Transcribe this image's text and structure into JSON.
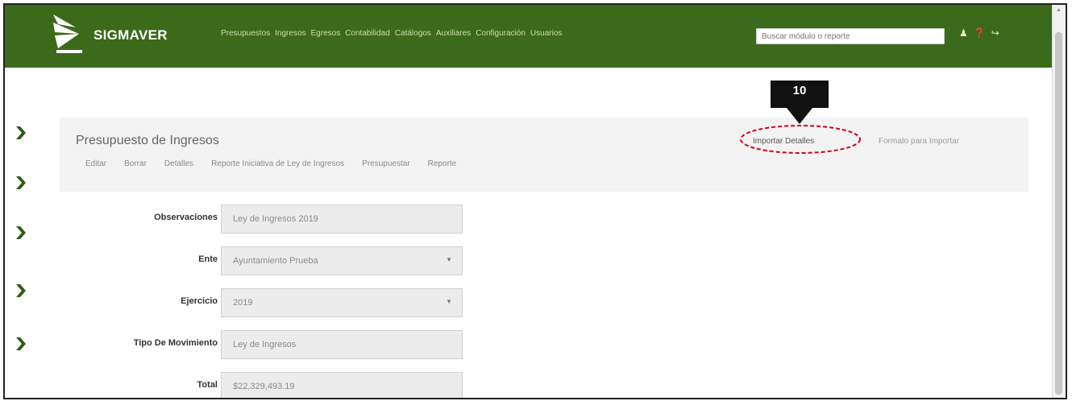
{
  "app": {
    "brand": "SIGMAVER"
  },
  "nav": {
    "links": [
      "Presupuestos",
      "Ingresos",
      "Egresos",
      "Contabilidad",
      "Catálogos",
      "Auxiliares",
      "Configuración",
      "Usuarios"
    ],
    "search_placeholder": "Buscar módulo o reporte"
  },
  "callout": {
    "number": "10"
  },
  "panel": {
    "title": "Presupuesto de Ingresos",
    "actions": [
      "Editar",
      "Borrar",
      "Detalles",
      "Reporte Iniciativa de Ley de Ingresos",
      "Presupuestar",
      "Reporte"
    ],
    "import_details": "Importar Detalles",
    "import_format": "Formato para Importar"
  },
  "form": {
    "observaciones": {
      "label": "Observaciones",
      "value": "Ley de Ingresos 2019"
    },
    "ente": {
      "label": "Ente",
      "value": "Ayuntamiento Prueba"
    },
    "ejercicio": {
      "label": "Ejercicio",
      "value": "2019"
    },
    "tipo_movimiento": {
      "label": "Tipo De Movimiento",
      "value": "Ley de Ingresos"
    },
    "total": {
      "label": "Total",
      "value": "$22,329,493.19"
    }
  },
  "colors": {
    "navbar": "#3b6a1a",
    "accent_green": "#3b6a1a",
    "callout_red": "#d0021b"
  }
}
